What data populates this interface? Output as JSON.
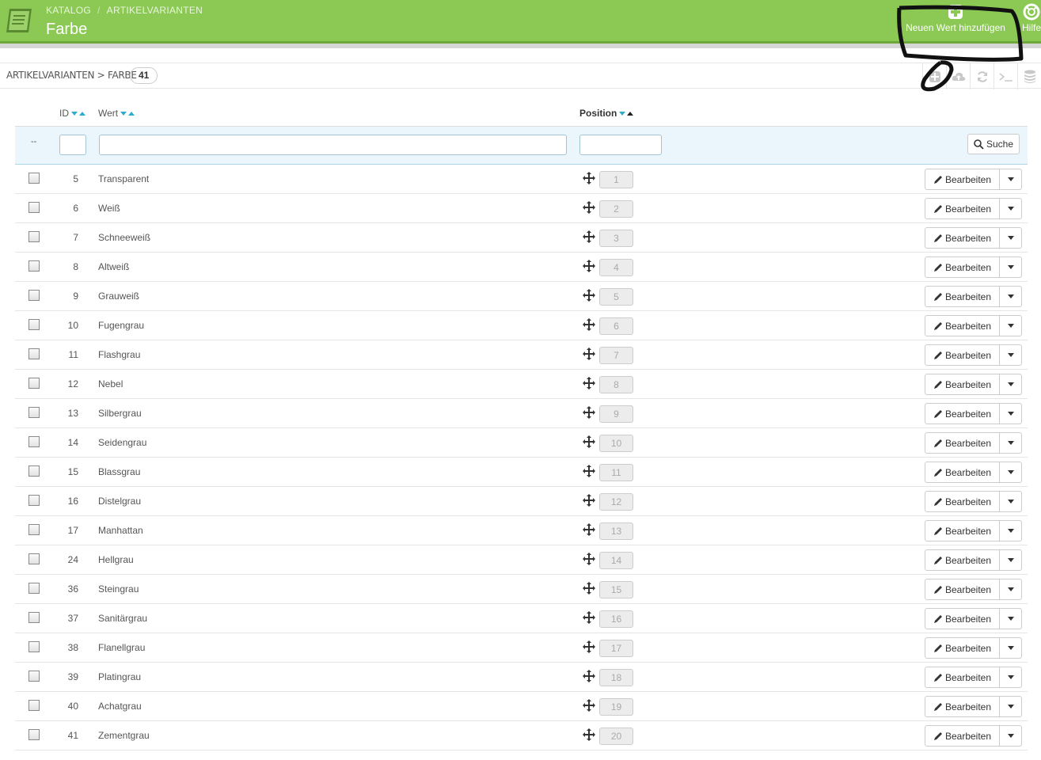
{
  "header": {
    "breadcrumb": [
      "KATALOG",
      "ARTIKELVARIANTEN"
    ],
    "title": "Farbe",
    "add_button_label": "Neuen Wert hinzufügen",
    "help_button_label": "Hilfe",
    "accent_color": "#8bc954"
  },
  "panel": {
    "title": "ARTIKELVARIANTEN > FARBE",
    "count": "41",
    "toolbar_icons": [
      "add-icon",
      "cloud-upload-icon",
      "refresh-icon",
      "terminal-icon",
      "database-icon"
    ]
  },
  "table": {
    "columns": {
      "id": "ID",
      "value": "Wert",
      "position": "Position"
    },
    "filter": {
      "dash": "--",
      "search_label": "Suche"
    },
    "edit_label": "Bearbeiten",
    "rows": [
      {
        "id": "5",
        "value": "Transparent",
        "position": "1"
      },
      {
        "id": "6",
        "value": "Weiß",
        "position": "2"
      },
      {
        "id": "7",
        "value": "Schneeweiß",
        "position": "3"
      },
      {
        "id": "8",
        "value": "Altweiß",
        "position": "4"
      },
      {
        "id": "9",
        "value": "Grauweiß",
        "position": "5"
      },
      {
        "id": "10",
        "value": "Fugengrau",
        "position": "6"
      },
      {
        "id": "11",
        "value": "Flashgrau",
        "position": "7"
      },
      {
        "id": "12",
        "value": "Nebel",
        "position": "8"
      },
      {
        "id": "13",
        "value": "Silbergrau",
        "position": "9"
      },
      {
        "id": "14",
        "value": "Seidengrau",
        "position": "10"
      },
      {
        "id": "15",
        "value": "Blassgrau",
        "position": "11"
      },
      {
        "id": "16",
        "value": "Distelgrau",
        "position": "12"
      },
      {
        "id": "17",
        "value": "Manhattan",
        "position": "13"
      },
      {
        "id": "24",
        "value": "Hellgrau",
        "position": "14"
      },
      {
        "id": "36",
        "value": "Steingrau",
        "position": "15"
      },
      {
        "id": "37",
        "value": "Sanitärgrau",
        "position": "16"
      },
      {
        "id": "38",
        "value": "Flanellgrau",
        "position": "17"
      },
      {
        "id": "39",
        "value": "Platingrau",
        "position": "18"
      },
      {
        "id": "40",
        "value": "Achatgrau",
        "position": "19"
      },
      {
        "id": "41",
        "value": "Zementgrau",
        "position": "20"
      }
    ]
  }
}
